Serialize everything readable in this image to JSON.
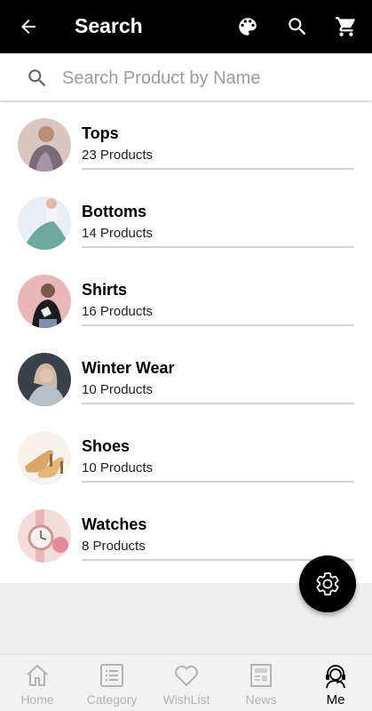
{
  "header": {
    "title": "Search",
    "back_icon": "arrow-left-icon",
    "actions": [
      "palette-icon",
      "search-icon",
      "cart-icon"
    ],
    "background": "#000000"
  },
  "search": {
    "placeholder": "Search Product by Name",
    "value": "",
    "icon": "search-icon"
  },
  "categories": [
    {
      "name": "Tops",
      "count": "23 Products",
      "thumb_colors": [
        "#c9a9a1",
        "#7b6b78"
      ]
    },
    {
      "name": "Bottoms",
      "count": "14 Products",
      "thumb_colors": [
        "#e9eef4",
        "#6fa99c"
      ]
    },
    {
      "name": "Shirts",
      "count": "16 Products",
      "thumb_colors": [
        "#e9b7b7",
        "#1c1c1c"
      ]
    },
    {
      "name": "Winter Wear",
      "count": "10 Products",
      "thumb_colors": [
        "#3b4148",
        "#cbb9a6"
      ]
    },
    {
      "name": "Shoes",
      "count": "10 Products",
      "thumb_colors": [
        "#f7f2ec",
        "#d9a766"
      ]
    },
    {
      "name": "Watches",
      "count": "8 Products",
      "thumb_colors": [
        "#f3dcdc",
        "#e48b9b"
      ]
    }
  ],
  "fab": {
    "icon": "gear-icon"
  },
  "bottom_nav": [
    {
      "label": "Home",
      "icon": "home-icon",
      "active": false
    },
    {
      "label": "Category",
      "icon": "list-icon",
      "active": false
    },
    {
      "label": "WishList",
      "icon": "heart-icon",
      "active": false
    },
    {
      "label": "News",
      "icon": "newspaper-icon",
      "active": false
    },
    {
      "label": "Me",
      "icon": "support-agent-icon",
      "active": true
    }
  ],
  "colors": {
    "accent": "#000000",
    "inactive_nav": "#b3b3b3",
    "divider": "#d4d4d4"
  }
}
